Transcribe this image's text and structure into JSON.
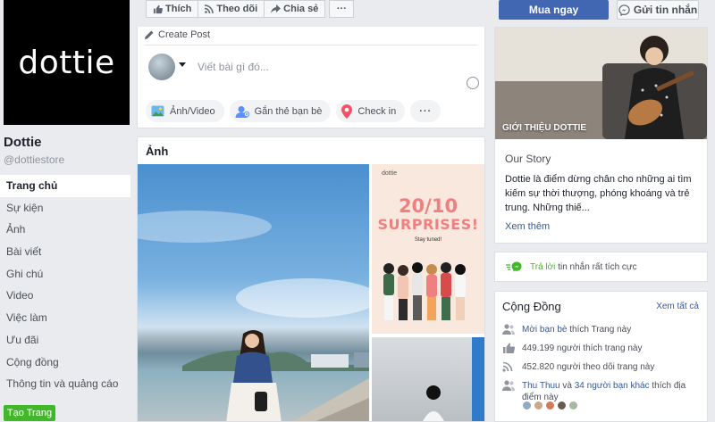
{
  "page": {
    "logo_text": "dottie",
    "name": "Dottie",
    "handle": "@dottiestore"
  },
  "left_nav": [
    {
      "label": "Trang chủ",
      "active": true
    },
    {
      "label": "Sự kiện"
    },
    {
      "label": "Ảnh"
    },
    {
      "label": "Bài viết"
    },
    {
      "label": "Ghi chú"
    },
    {
      "label": "Video"
    },
    {
      "label": "Việc làm"
    },
    {
      "label": "Ưu đãi"
    },
    {
      "label": "Cộng đồng"
    },
    {
      "label": "Thông tin và quảng cáo"
    }
  ],
  "create_page_label": "Tạo Trang",
  "action_bar": {
    "like": "Thích",
    "follow": "Theo dõi",
    "share": "Chia sẻ",
    "more": "···"
  },
  "buy_label": "Mua ngay",
  "message_label": "Gửi tin nhắn",
  "composer": {
    "header": "Create Post",
    "placeholder": "Viết bài gì đó...",
    "actions": [
      "Ảnh/Video",
      "Gắn thẻ bạn bè",
      "Check in"
    ],
    "more": "···"
  },
  "photos": {
    "title": "Ảnh",
    "promo": {
      "brand": "dottie",
      "line1": "20/10",
      "line2": "SURPRISES!",
      "sub": "Stay tuned!"
    }
  },
  "intro": {
    "photo_label": "GIỚI THIỆU DOTTIE",
    "story_title": "Our Story",
    "story_text": "Dottie là điểm dừng chân cho những ai tìm kiếm sự thời thượng, phóng khoáng và trẻ trung. Những thiế...",
    "see_more": "Xem thêm"
  },
  "response": {
    "highlight": "Trả lời",
    "rest": " tin nhắn rất tích cực"
  },
  "community": {
    "title": "Cộng Đồng",
    "see_all": "Xem tất cả",
    "invite_link": "Mời bạn bè",
    "invite_rest": " thích Trang này",
    "likes": "449.199 người thích trang này",
    "follows": "452.820 người theo dõi trang này",
    "friend_a": "Thu Thuu",
    "friend_and": " và ",
    "friend_b": "34 người bạn khác",
    "friend_rest": " thích địa điểm này"
  },
  "colors": {
    "accent": "#4267b2",
    "green": "#42b72a",
    "link": "#365899",
    "promo_pink": "#f08080"
  }
}
